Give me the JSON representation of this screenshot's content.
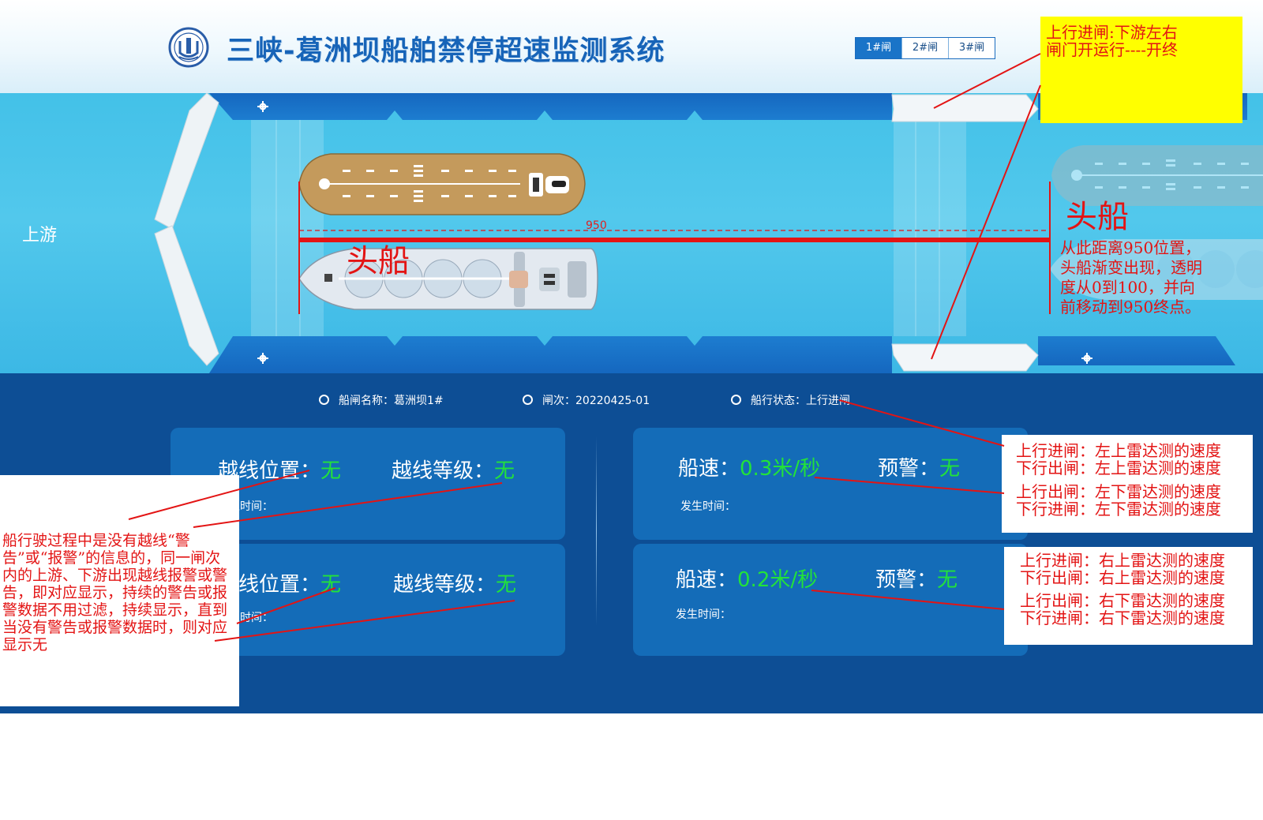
{
  "app": {
    "title": "三峡-葛洲坝船舶禁停超速监测系统",
    "tabs": [
      {
        "label": "1#闸",
        "active": true
      },
      {
        "label": "2#闸",
        "active": false
      },
      {
        "label": "3#闸",
        "active": false
      }
    ]
  },
  "lock_view": {
    "upstream_label": "上游",
    "distance_label": "950",
    "head_ship_label_left": "头船",
    "head_ship_label_right": "头船"
  },
  "info_bar": {
    "lock_name": "船闸名称：葛洲坝1#",
    "lock_batch": "闸次：20220425-01",
    "status_label": "船行状态：",
    "status_value": "上行进闸"
  },
  "cards": {
    "upstream_line": {
      "pos_label": "越线位置：",
      "pos_value": "无",
      "level_label": "越线等级：",
      "level_value": "无",
      "time_label": "发生时间："
    },
    "downstream_line": {
      "pos_label": "越线位置：",
      "pos_value": "无",
      "level_label": "越线等级：",
      "level_value": "无",
      "time_label": "发生时间："
    },
    "left_speed": {
      "speed_label": "船速：",
      "speed_value": "0.3米/秒",
      "warn_label": "预警：",
      "warn_value": "无",
      "time_label": "发生时间："
    },
    "right_speed": {
      "speed_label": "船速：",
      "speed_value": "0.2米/秒",
      "warn_label": "预警：",
      "warn_value": "无",
      "time_label": "发生时间："
    }
  },
  "annotations": {
    "top_note": "上行进闸:下游左右闸门开运行----开终",
    "right_note": "从此距离950位置，头船渐变出现，透明度从0到100，并向前移动到950终点。",
    "left_note": "船行驶过程中是没有越线“警告”或“报警”的信息的，同一闸次内的上游、下游出现越线报警或警告，即对应显示，持续的警告或报警数据不用过滤，持续显示，直到当没有警告或报警数据时，则对应显示无",
    "radar_upper_left": [
      "上行进闸：左上雷达测的速度",
      "下行出闸：左上雷达测的速度",
      "上行出闸：左下雷达测的速度",
      "下行进闸：左下雷达测的速度"
    ],
    "radar_lower_right": [
      "上行进闸：右上雷达测的速度",
      "下行出闸：右上雷达测的速度",
      "上行出闸：右下雷达测的速度",
      "下行进闸：右下雷达测的速度"
    ]
  },
  "colors": {
    "header_title": "#1764b8",
    "water": "#43c1e8",
    "panel": "#0d4e95",
    "card": "#146cb8",
    "value_green": "#22e23a",
    "annotation_red": "#e31414",
    "note_yellow": "#ffff00"
  }
}
